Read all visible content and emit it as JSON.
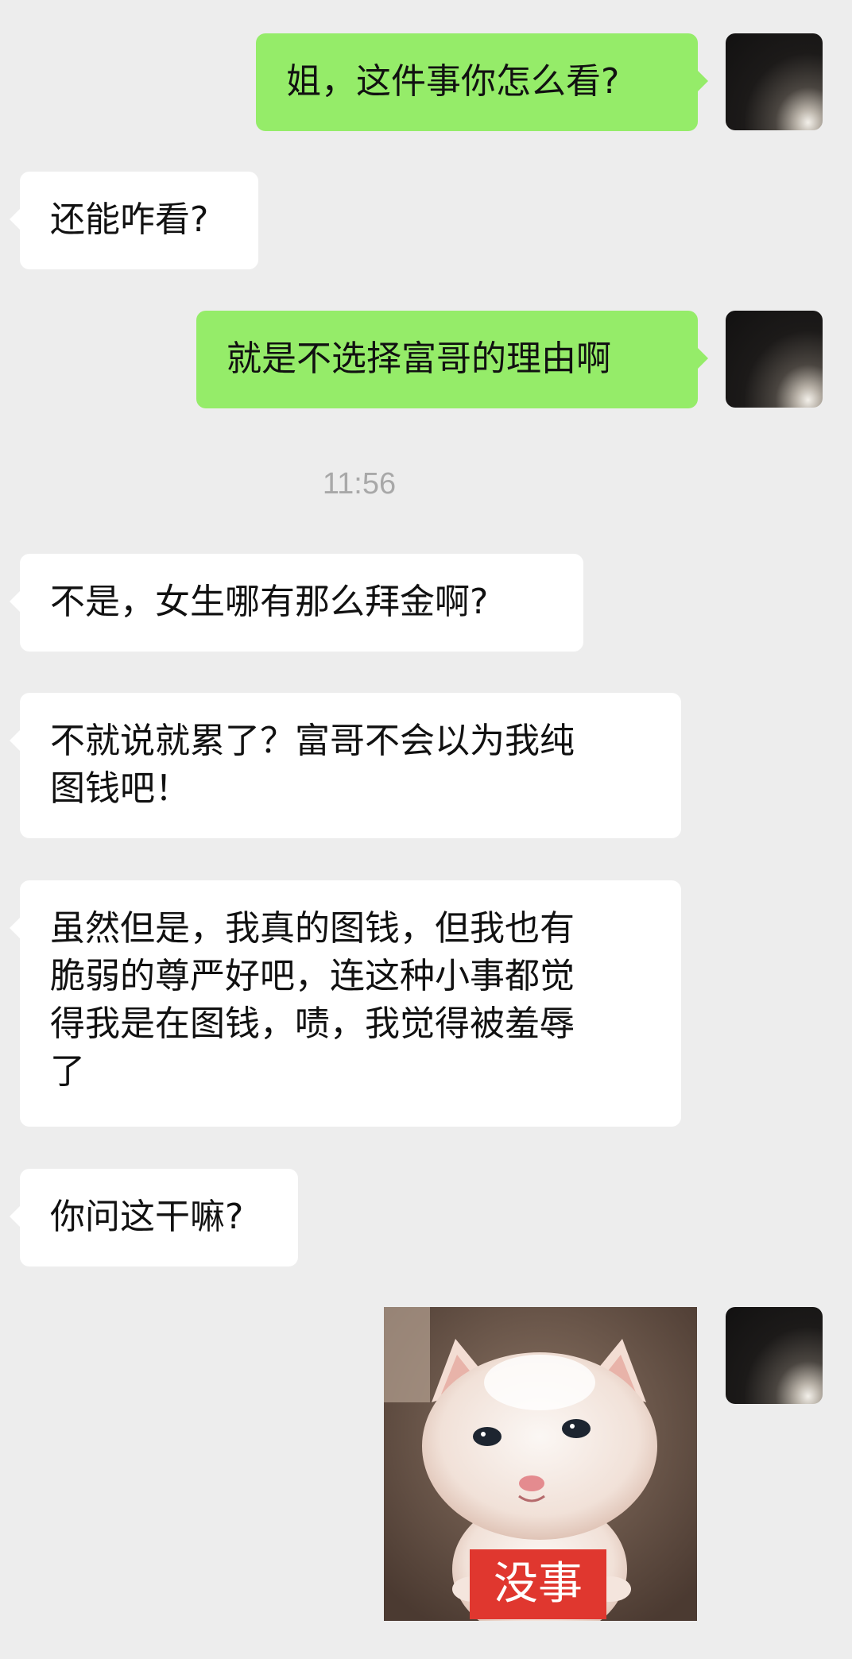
{
  "messages": [
    {
      "sender": "me",
      "text": "姐，这件事你怎么看?"
    },
    {
      "sender": "other",
      "text": "还能咋看?"
    },
    {
      "sender": "me",
      "text": "就是不选择富哥的理由啊"
    },
    {
      "type": "timestamp",
      "text": "11:56"
    },
    {
      "sender": "other",
      "text": "不是，女生哪有那么拜金啊?"
    },
    {
      "sender": "other",
      "text": "不就说就累了？富哥不会以为我纯\n图钱吧！"
    },
    {
      "sender": "other",
      "text": "虽然但是，我真的图钱，但我也有\n脆弱的尊严好吧，连这种小事都觉\n得我是在图钱，啧，我觉得被羞辱\n了"
    },
    {
      "sender": "other",
      "text": "你问这干嘛?"
    },
    {
      "sender": "me",
      "type": "sticker",
      "caption": "没事",
      "subject": "kitten-photo"
    }
  ],
  "colors": {
    "my_bubble": "#95ec69",
    "their_bubble": "#ffffff",
    "background": "#ededed",
    "timestamp_text": "#a8a8a8",
    "sticker_caption_bg": "#e0372f"
  }
}
